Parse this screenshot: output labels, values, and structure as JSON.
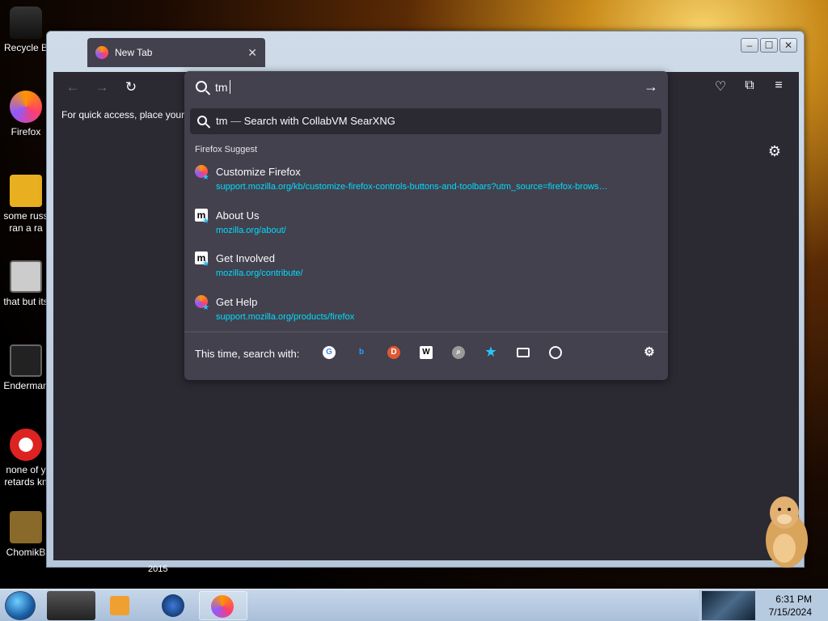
{
  "desktop": {
    "icons": [
      {
        "label": "Recycle B"
      },
      {
        "label": "Firefox"
      },
      {
        "label": "some russ ran a ra"
      },
      {
        "label": "that but its"
      },
      {
        "label": "Enderman"
      },
      {
        "label": "none of y retards kn"
      },
      {
        "label": "ChomikB"
      }
    ],
    "under_window_label": "2015"
  },
  "browser": {
    "tab_title": "New Tab",
    "tab_close": "✕",
    "bookmarks_text": "For quick access, place your b",
    "window_controls": {
      "minimize": "–",
      "maximize": "☐",
      "close": "✕"
    }
  },
  "urlbar": {
    "typed_text": "tm",
    "search_suggestion": {
      "query": "tm",
      "dash": "—",
      "action": "Search with CollabVM SearXNG"
    },
    "section_title": "Firefox Suggest",
    "results": [
      {
        "title": "Customize Firefox",
        "url": "support.mozilla.org/kb/customize-firefox-controls-buttons-and-toolbars?utm_source=firefox-brows…",
        "icon": "firefox-icon"
      },
      {
        "title": "About Us",
        "url": "mozilla.org/about/",
        "icon": "mozilla-icon"
      },
      {
        "title": "Get Involved",
        "url": "mozilla.org/contribute/",
        "icon": "mozilla-icon"
      },
      {
        "title": "Get Help",
        "url": "support.mozilla.org/products/firefox",
        "icon": "firefox-icon"
      }
    ],
    "one_off_label": "This time, search with:",
    "engines": [
      "Google",
      "Bing",
      "DuckDuckGo",
      "Wikipedia",
      "SearXNG",
      "Bookmarks",
      "Tabs",
      "History"
    ]
  },
  "taskbar": {
    "time": "6:31 PM",
    "date": "7/15/2024"
  },
  "colors": {
    "chrome_bg": "#2b2a33",
    "popup_bg": "#42414d",
    "url_accent": "#00ddff"
  }
}
